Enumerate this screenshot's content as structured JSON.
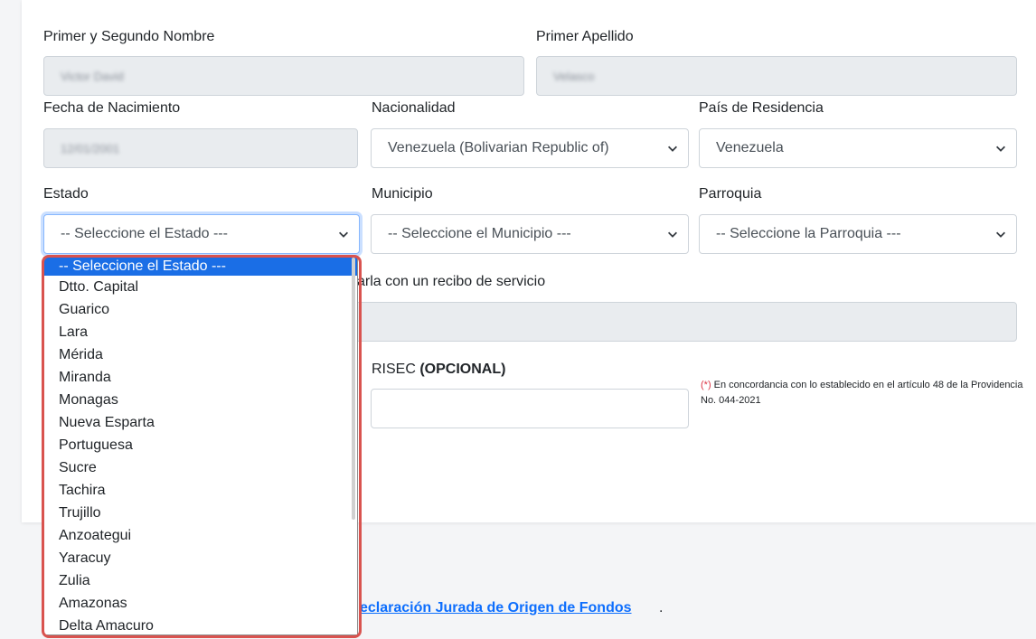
{
  "form": {
    "first_name_label": "Primer y Segundo Nombre",
    "first_name_value": "Victor David",
    "last_name_label": "Primer Apellido",
    "last_name_value": "Velasco",
    "birthdate_label": "Fecha de Nacimiento",
    "birthdate_value": "12/01/2001",
    "nationality_label": "Nacionalidad",
    "nationality_value": "Venezuela (Bolivarian Republic of)",
    "residence_label": "País de Residencia",
    "residence_value": "Venezuela",
    "state_label": "Estado",
    "state_value": "-- Seleccione el Estado ---",
    "municipality_label": "Municipio",
    "municipality_value": "-- Seleccione el Municipio ---",
    "parish_label": "Parroquia",
    "parish_value": "-- Seleccione la Parroquia ---",
    "address_label_partial": "arla con un recibo de servicio",
    "risec_label": "RISEC ",
    "risec_optional": "(OPCIONAL)",
    "note_marker": "(*)",
    "note_text": " En concordancia con lo establecido en el artículo 48 de la Providencia No. 044-2021",
    "declaration_link": "eclaración Jurada de Origen de Fondos",
    "declaration_suffix": "."
  },
  "state_dropdown": {
    "options": [
      "-- Seleccione el Estado ---",
      "Dtto. Capital",
      "Guarico",
      "Lara",
      "Mérida",
      "Miranda",
      "Monagas",
      "Nueva Esparta",
      "Portuguesa",
      "Sucre",
      "Tachira",
      "Trujillo",
      "Anzoategui",
      "Yaracuy",
      "Zulia",
      "Amazonas",
      "Delta Amacuro"
    ],
    "selected_index": 0
  },
  "colors": {
    "accent": "#1a6ee6",
    "highlight_frame": "#d9534f",
    "link": "#0d6efd",
    "required": "#dc3545"
  }
}
